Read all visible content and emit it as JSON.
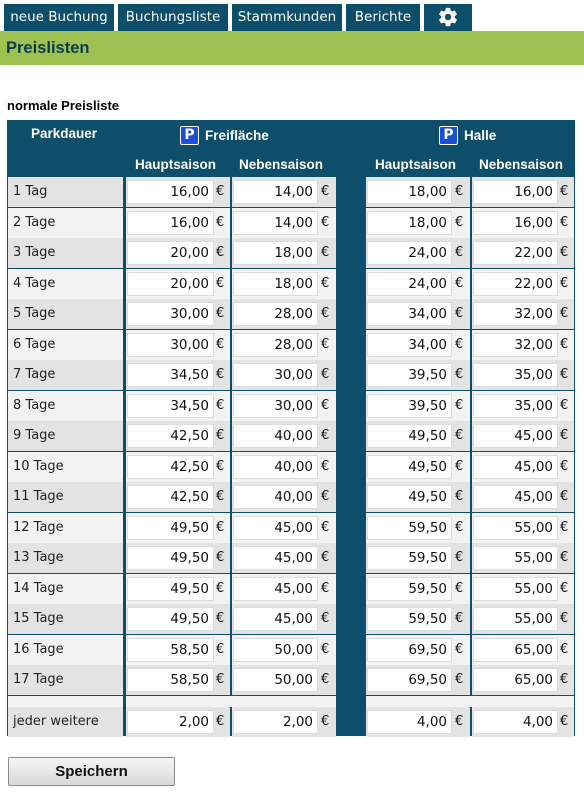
{
  "nav": {
    "tabs": [
      {
        "label": "neue Buchung"
      },
      {
        "label": "Buchungsliste"
      },
      {
        "label": "Stammkunden"
      },
      {
        "label": "Berichte"
      }
    ],
    "settings_icon": "gear-icon"
  },
  "page_title": "Preislisten",
  "section_title": "normale Preisliste",
  "table": {
    "col_label": "Parkdauer",
    "zone_badge": "P",
    "zones": [
      "Freifläche",
      "Halle"
    ],
    "seasons": [
      "Hauptsaison",
      "Nebensaison",
      "Hauptsaison",
      "Nebensaison"
    ],
    "currency": "€",
    "rows": [
      {
        "label": "1 Tag",
        "values": [
          "16,00",
          "14,00",
          "18,00",
          "16,00"
        ]
      },
      {
        "label": "2 Tage",
        "values": [
          "16,00",
          "14,00",
          "18,00",
          "16,00"
        ]
      },
      {
        "label": "3 Tage",
        "values": [
          "20,00",
          "18,00",
          "24,00",
          "22,00"
        ]
      },
      {
        "label": "4 Tage",
        "values": [
          "20,00",
          "18,00",
          "24,00",
          "22,00"
        ]
      },
      {
        "label": "5 Tage",
        "values": [
          "30,00",
          "28,00",
          "34,00",
          "32,00"
        ]
      },
      {
        "label": "6 Tage",
        "values": [
          "30,00",
          "28,00",
          "34,00",
          "32,00"
        ]
      },
      {
        "label": "7 Tage",
        "values": [
          "34,50",
          "30,00",
          "39,50",
          "35,00"
        ]
      },
      {
        "label": "8 Tage",
        "values": [
          "34,50",
          "30,00",
          "39,50",
          "35,00"
        ]
      },
      {
        "label": "9 Tage",
        "values": [
          "42,50",
          "40,00",
          "49,50",
          "45,00"
        ]
      },
      {
        "label": "10 Tage",
        "values": [
          "42,50",
          "40,00",
          "49,50",
          "45,00"
        ]
      },
      {
        "label": "11 Tage",
        "values": [
          "42,50",
          "40,00",
          "49,50",
          "45,00"
        ]
      },
      {
        "label": "12 Tage",
        "values": [
          "49,50",
          "45,00",
          "59,50",
          "55,00"
        ]
      },
      {
        "label": "13 Tage",
        "values": [
          "49,50",
          "45,00",
          "59,50",
          "55,00"
        ]
      },
      {
        "label": "14 Tage",
        "values": [
          "49,50",
          "45,00",
          "59,50",
          "55,00"
        ]
      },
      {
        "label": "15 Tage",
        "values": [
          "49,50",
          "45,00",
          "59,50",
          "55,00"
        ]
      },
      {
        "label": "16 Tage",
        "values": [
          "58,50",
          "50,00",
          "69,50",
          "65,00"
        ]
      },
      {
        "label": "17 Tage",
        "values": [
          "58,50",
          "50,00",
          "69,50",
          "65,00"
        ]
      }
    ],
    "extra_row": {
      "label": "jeder weitere",
      "values": [
        "2,00",
        "2,00",
        "4,00",
        "4,00"
      ]
    }
  },
  "save_label": "Speichern",
  "colors": {
    "nav": "#0d4f6b",
    "titlebar": "#9dc251",
    "badge": "#1b4fd6"
  }
}
